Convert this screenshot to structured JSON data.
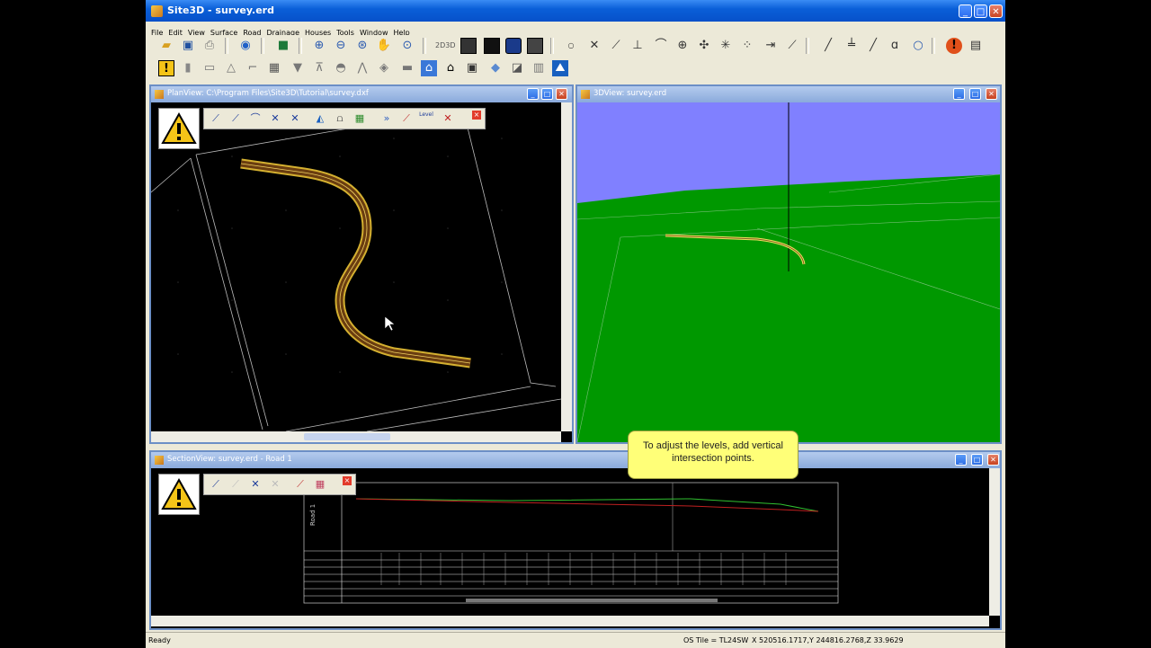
{
  "app": {
    "title": "Site3D - survey.erd"
  },
  "menu": [
    "File",
    "Edit",
    "View",
    "Surface",
    "Road",
    "Drainage",
    "Houses",
    "Tools",
    "Window",
    "Help"
  ],
  "toolbar1_icons": [
    "open-icon",
    "save-icon",
    "print-icon",
    "back-icon",
    "layers-icon",
    "zoom-in-icon",
    "zoom-out-icon",
    "zoom-window-icon",
    "pan-hand-icon",
    "zoom-extents-icon",
    "2d-3d-icon",
    "render-dark-icon",
    "render-black-icon",
    "globe-icon",
    "render-gray-icon",
    "point-icon",
    "cross-icon",
    "line-node-icon",
    "level-icon",
    "arc-icon",
    "target-icon",
    "move-icon",
    "star-icon",
    "dots-icon",
    "extend-icon",
    "ruler-icon",
    "line-icon",
    "dimension-icon",
    "diagonal-icon",
    "node-icon",
    "circle-icon",
    "alert-icon",
    "table-icon"
  ],
  "toolbar2_icons": [
    "warning-icon",
    "column-icon",
    "kerb-icon",
    "triangle-icon",
    "stairs-icon",
    "grid-icon",
    "road-icon",
    "ramp-icon",
    "dome-icon",
    "arch-icon",
    "slab-icon",
    "slope-icon",
    "house-blue-icon",
    "house-black-icon",
    "calculator-icon",
    "shapes-icon",
    "section-icon",
    "wall-icon",
    "terrain-icon"
  ],
  "plan_view": {
    "title": "PlanView: C:\\Program Files\\Site3D\\Tutorial\\survey.dxf",
    "float_toolbar_label": "Level"
  },
  "view_3d": {
    "title": "3DView: survey.erd",
    "sky_color": "#8080ff",
    "ground_color": "#009800"
  },
  "section_view": {
    "title": "SectionView: survey.erd - Road 1",
    "road_label": "Road 1"
  },
  "callout": {
    "text": "To adjust the levels, add vertical intersection points."
  },
  "status": {
    "left": "Ready",
    "os_tile": "OS Tile = TL24SW",
    "coords": "X 520516.1717,Y 244816.2768,Z 33.9629"
  }
}
